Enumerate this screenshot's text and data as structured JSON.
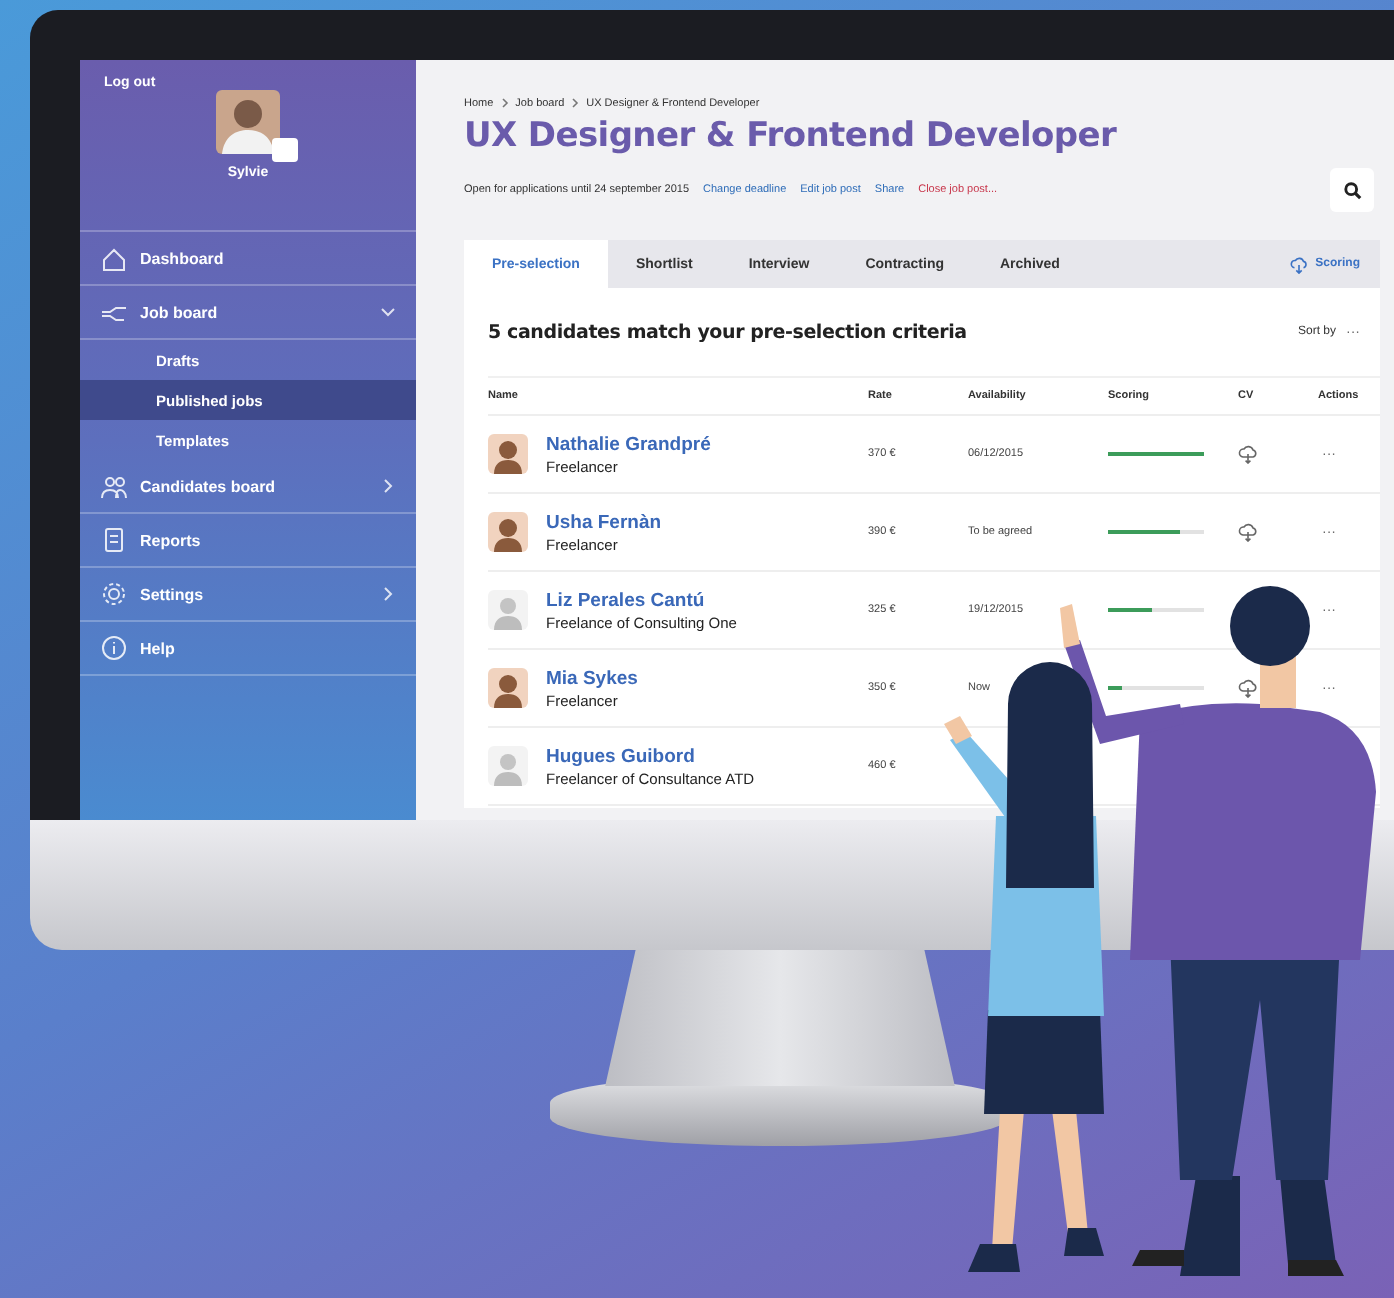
{
  "sidebar": {
    "logout": "Log out",
    "user": {
      "name": "Sylvie"
    },
    "items": [
      {
        "label": "Dashboard",
        "selected": false,
        "expandable": false
      },
      {
        "label": "Job board",
        "selected": false,
        "expandable": true,
        "expanded": true,
        "children": [
          {
            "label": "Drafts",
            "selected": false
          },
          {
            "label": "Published jobs",
            "selected": true
          },
          {
            "label": "Templates",
            "selected": false
          }
        ]
      },
      {
        "label": "Candidates board",
        "selected": false,
        "expandable": true,
        "expanded": false
      },
      {
        "label": "Reports",
        "selected": false,
        "expandable": false
      },
      {
        "label": "Settings",
        "selected": false,
        "expandable": true,
        "expanded": false
      },
      {
        "label": "Help",
        "selected": false,
        "expandable": false
      }
    ]
  },
  "breadcrumb": [
    "Home",
    "Job board",
    "UX Designer & Frontend Developer"
  ],
  "title": "UX Designer & Frontend Developer",
  "deadline": "Open for applications until 24 september 2015",
  "actions": [
    {
      "label": "Change deadline",
      "kind": "link"
    },
    {
      "label": "Edit job post",
      "kind": "link"
    },
    {
      "label": "Share",
      "kind": "link"
    },
    {
      "label": "Close job post...",
      "kind": "danger"
    }
  ],
  "tabs": [
    {
      "label": "Pre-selection",
      "selected": true
    },
    {
      "label": "Shortlist",
      "selected": false
    },
    {
      "label": "Interview",
      "selected": false
    },
    {
      "label": "Contracting",
      "selected": false
    },
    {
      "label": "Archived",
      "selected": false
    }
  ],
  "scoring_link": "Scoring",
  "card": {
    "heading": "5 candidates match your pre-selection criteria",
    "sort_label": "Sort by",
    "sort_menu": "···"
  },
  "table": {
    "columns": [
      "Name",
      "Rate",
      "Availability",
      "Scoring",
      "CV",
      "Actions"
    ],
    "rows": [
      {
        "name": "Nathalie Grandpré",
        "subtitle": "Freelancer",
        "kind": "photo",
        "rate": "370 €",
        "availability": "06/12/2015",
        "level": 1.0,
        "cv": true,
        "actions": "···"
      },
      {
        "name": "Usha Fernàn",
        "subtitle": "Freelancer",
        "kind": "photo",
        "rate": "390 €",
        "availability": "To be agreed",
        "level": 0.75,
        "cv": true,
        "actions": "···"
      },
      {
        "name": "Liz Perales Cantú",
        "subtitle": "Freelance of Consulting One",
        "kind": "default",
        "rate": "325 €",
        "availability": "19/12/2015",
        "level": 0.45,
        "actions": "···"
      },
      {
        "name": "Mia Sykes",
        "subtitle": "Freelancer",
        "kind": "photo",
        "rate": "350 €",
        "availability": "Now",
        "level": 0.15,
        "cv": true,
        "actions": "···"
      },
      {
        "name": "Hugues Guibord",
        "subtitle": "Freelancer of Consultance ATD",
        "kind": "default",
        "rate": "460 €"
      }
    ]
  }
}
